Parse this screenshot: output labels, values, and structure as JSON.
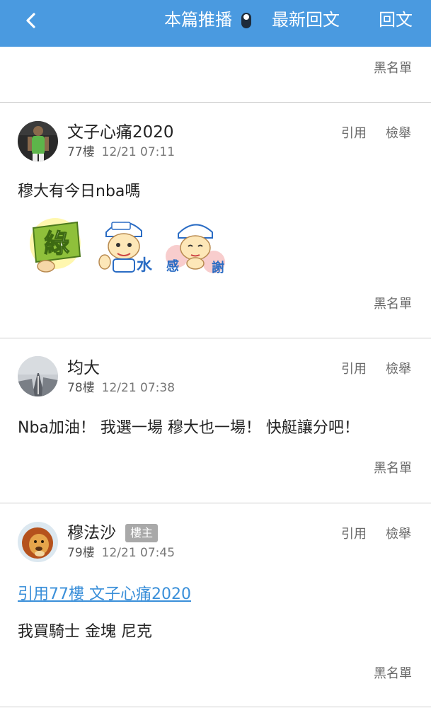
{
  "topbar": {
    "back_icon": "chevron-left-icon",
    "recommend_label": "本篇推播",
    "latest_label": "最新回文",
    "reply_label": "回文",
    "bar_color": "#4a9ae0"
  },
  "blacklist_label": "黑名單",
  "posts": [
    {
      "username": "文子心痛2020",
      "floor": "77樓",
      "time": "12/21 07:11",
      "quote_label": "引用",
      "report_label": "檢舉",
      "content": "穆大有今日nba嗎",
      "stickers": [
        {
          "icon": "green-sticker-icon",
          "text": "綠"
        },
        {
          "icon": "water-sticker-icon",
          "text": "水"
        },
        {
          "icon": "thanks-sticker-icon",
          "text_a": "感",
          "text_b": "謝"
        }
      ]
    },
    {
      "username": "均大",
      "floor": "78樓",
      "time": "12/21 07:38",
      "quote_label": "引用",
      "report_label": "檢舉",
      "content": "Nba加油！ 我選一場 穆大也一場！ 快艇讓分吧！"
    },
    {
      "username": "穆法沙",
      "badge": "樓主",
      "floor": "79樓",
      "time": "12/21 07:45",
      "quote_label": "引用",
      "report_label": "檢舉",
      "quote_ref": "引用77樓 文子心痛2020",
      "content": "我買騎士 金塊 尼克"
    }
  ]
}
